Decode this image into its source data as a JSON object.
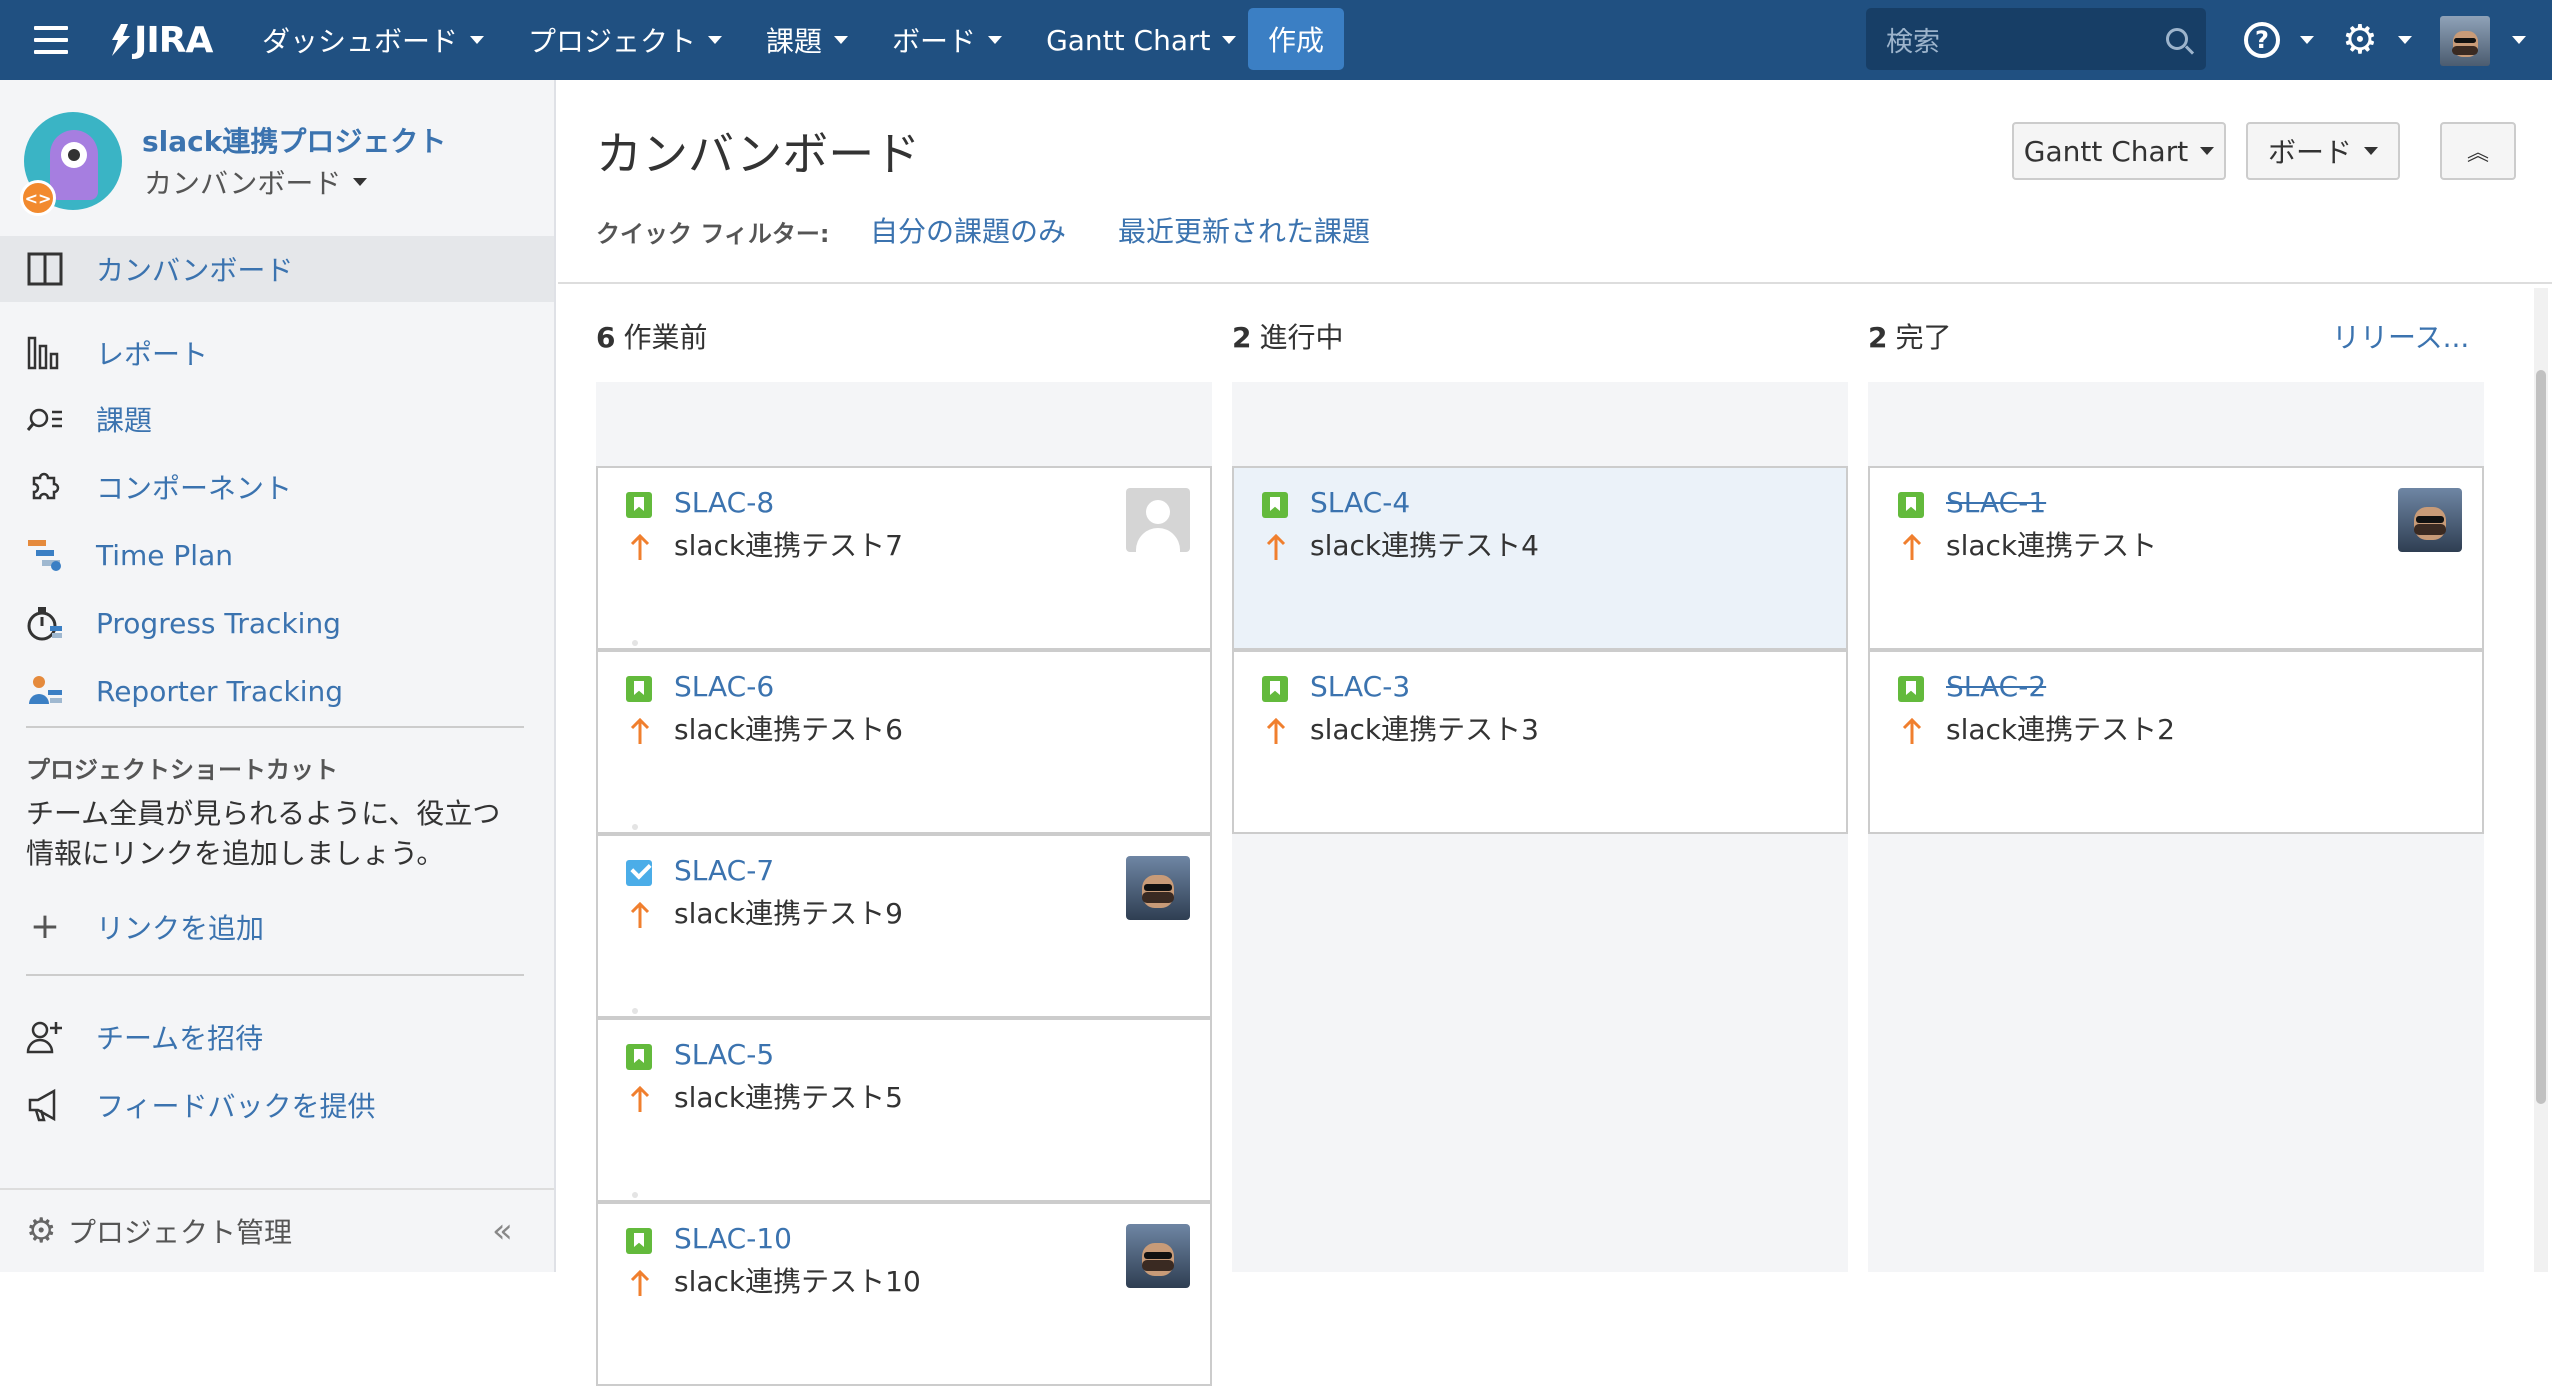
{
  "topbar": {
    "logo": "JIRA",
    "nav": [
      "ダッシュボード",
      "プロジェクト",
      "課題",
      "ボード",
      "Gantt Chart"
    ],
    "create_label": "作成",
    "search_placeholder": "検索"
  },
  "sidebar": {
    "project_name": "slack連携プロジェクト",
    "board_name": "カンバンボード",
    "items": [
      {
        "label": "カンバンボード",
        "icon": "board-icon"
      },
      {
        "label": "レポート",
        "icon": "reports-icon"
      },
      {
        "label": "課題",
        "icon": "issues-search-icon"
      },
      {
        "label": "コンポーネント",
        "icon": "puzzle-icon"
      },
      {
        "label": "Time Plan",
        "icon": "time-plan-icon"
      },
      {
        "label": "Progress Tracking",
        "icon": "progress-tracking-icon"
      },
      {
        "label": "Reporter Tracking",
        "icon": "reporter-tracking-icon"
      }
    ],
    "shortcuts_heading": "プロジェクトショートカット",
    "shortcuts_text": "チーム全員が見られるように、役立つ情報にリンクを追加しましょう。",
    "add_link": "リンクを追加",
    "invite_team": "チームを招待",
    "feedback": "フィードバックを提供",
    "project_settings": "プロジェクト管理"
  },
  "board": {
    "title": "カンバンボード",
    "gantt_button": "Gantt Chart",
    "board_button": "ボード",
    "quick_filter_label": "クイック フィルター:",
    "quick_filters": [
      "自分の課題のみ",
      "最近更新された課題"
    ],
    "release_link": "リリース...",
    "columns": [
      {
        "count": "6",
        "name": "作業前",
        "cards": [
          {
            "key": "SLAC-8",
            "summary": "slack連携テスト7",
            "type": "story",
            "avatar": "blank"
          },
          {
            "key": "SLAC-6",
            "summary": "slack連携テスト6",
            "type": "story",
            "avatar": "none"
          },
          {
            "key": "SLAC-7",
            "summary": "slack連携テスト9",
            "type": "task",
            "avatar": "user"
          },
          {
            "key": "SLAC-5",
            "summary": "slack連携テスト5",
            "type": "story",
            "avatar": "none"
          },
          {
            "key": "SLAC-10",
            "summary": "slack連携テスト10",
            "type": "story",
            "avatar": "user"
          }
        ]
      },
      {
        "count": "2",
        "name": "進行中",
        "cards": [
          {
            "key": "SLAC-4",
            "summary": "slack連携テスト4",
            "type": "story",
            "avatar": "none"
          },
          {
            "key": "SLAC-3",
            "summary": "slack連携テスト3",
            "type": "story",
            "avatar": "none"
          }
        ]
      },
      {
        "count": "2",
        "name": "完了",
        "cards": [
          {
            "key": "SLAC-1",
            "summary": "slack連携テスト",
            "type": "story",
            "avatar": "user"
          },
          {
            "key": "SLAC-2",
            "summary": "slack連携テスト2",
            "type": "story",
            "avatar": "none"
          }
        ]
      }
    ]
  },
  "colors": {
    "header": "#205081",
    "link": "#3b73af",
    "create_button": "#3b7fc4",
    "story_icon": "#63ba3c",
    "task_icon": "#4bade8",
    "priority": "#f07f2e"
  }
}
